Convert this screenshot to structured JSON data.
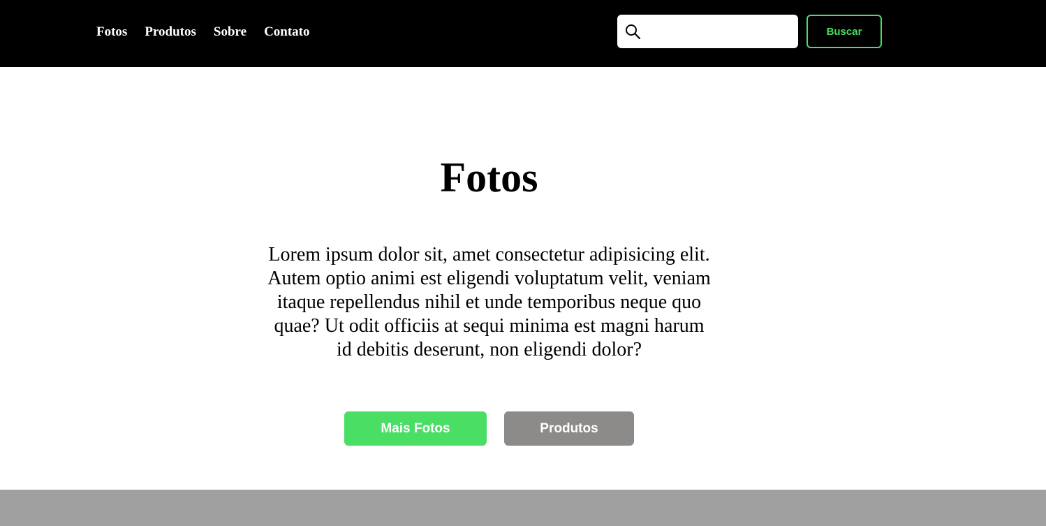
{
  "header": {
    "nav": [
      {
        "label": "Fotos"
      },
      {
        "label": "Produtos"
      },
      {
        "label": "Sobre"
      },
      {
        "label": "Contato"
      }
    ],
    "search": {
      "icon": "search-icon",
      "value": "",
      "placeholder": ""
    },
    "buscar_label": "Buscar"
  },
  "hero": {
    "title": "Fotos",
    "text": "Lorem ipsum dolor sit, amet consectetur adipisicing elit. Autem optio animi est eligendi voluptatum velit, veniam itaque repellendus nihil et unde temporibus neque quo quae? Ut odit officiis at sequi minima est magni harum id debitis deserunt, non eligendi dolor?",
    "primary_label": "Mais Fotos",
    "secondary_label": "Produtos"
  },
  "colors": {
    "header_bg": "#000000",
    "accent_green": "#4ade64",
    "secondary_gray": "#8c8b89",
    "footer_bg": "#a0a0a0"
  }
}
